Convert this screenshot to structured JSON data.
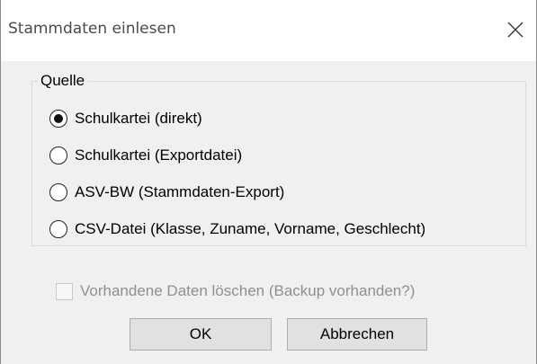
{
  "window": {
    "title": "Stammdaten einlesen",
    "close_icon": "close-icon"
  },
  "source_group": {
    "legend": "Quelle",
    "selected_index": 0,
    "options": [
      {
        "label": "Schulkartei (direkt)",
        "checked": true
      },
      {
        "label": "Schulkartei (Exportdatei)",
        "checked": false
      },
      {
        "label": "ASV-BW (Stammdaten-Export)",
        "checked": false
      },
      {
        "label": "CSV-Datei (Klasse, Zuname, Vorname, Geschlecht)",
        "checked": false
      }
    ]
  },
  "delete_option": {
    "label": "Vorhandene Daten löschen (Backup vorhanden?)",
    "checked": false,
    "enabled": false
  },
  "buttons": {
    "ok": "OK",
    "cancel": "Abbrechen"
  }
}
